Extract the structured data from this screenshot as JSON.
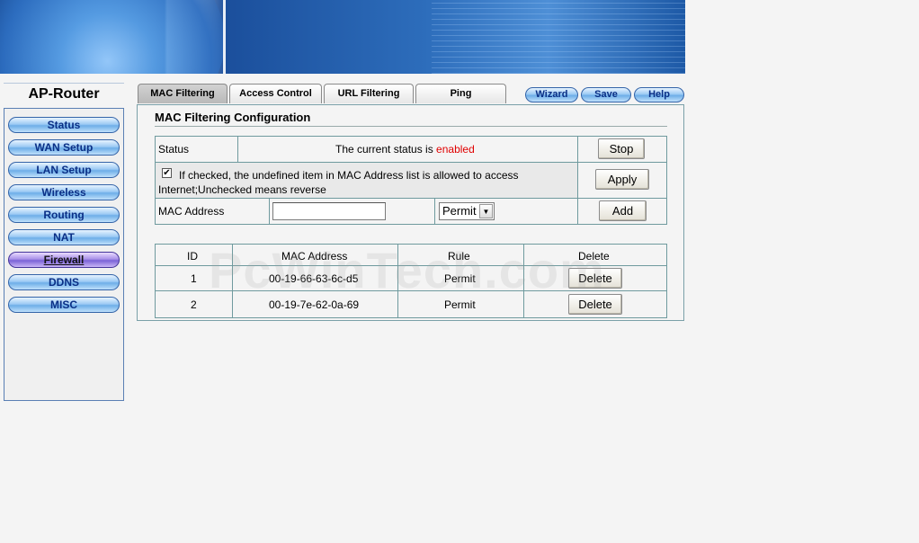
{
  "brand": {
    "title": "AP-Router"
  },
  "sidebar": {
    "items": [
      {
        "label": "Status"
      },
      {
        "label": "WAN Setup"
      },
      {
        "label": "LAN Setup"
      },
      {
        "label": "Wireless"
      },
      {
        "label": "Routing"
      },
      {
        "label": "NAT"
      },
      {
        "label": "Firewall",
        "active": true
      },
      {
        "label": "DDNS"
      },
      {
        "label": "MISC"
      }
    ]
  },
  "tabs": [
    {
      "label": "MAC Filtering",
      "active": true
    },
    {
      "label": "Access Control"
    },
    {
      "label": "URL Filtering"
    },
    {
      "label": "Ping"
    }
  ],
  "top_buttons": {
    "wizard": "Wizard",
    "save": "Save",
    "help": "Help"
  },
  "section": {
    "title": "MAC Filtering Configuration"
  },
  "status_row": {
    "label": "Status",
    "text_prefix": "The current status is ",
    "status_value": "enabled",
    "button": "Stop"
  },
  "policy_row": {
    "checked": true,
    "text_line1": "If checked, the undefined item in MAC Address list is allowed to access",
    "text_line2": "Internet;Unchecked means reverse",
    "button": "Apply"
  },
  "add_row": {
    "label": "MAC Address",
    "input_value": "",
    "rule_selected": "Permit",
    "button": "Add"
  },
  "table": {
    "headers": [
      "ID",
      "MAC Address",
      "Rule",
      "Delete"
    ],
    "rows": [
      {
        "id": "1",
        "mac": "00-19-66-63-6c-d5",
        "rule": "Permit",
        "action": "Delete"
      },
      {
        "id": "2",
        "mac": "00-19-7e-62-0a-69",
        "rule": "Permit",
        "action": "Delete"
      }
    ]
  },
  "watermark": "PcWinTech.com",
  "colors": {
    "status_enabled": "#e00000",
    "table_border": "#6f9a9e",
    "nav_text": "#0a2f86"
  }
}
